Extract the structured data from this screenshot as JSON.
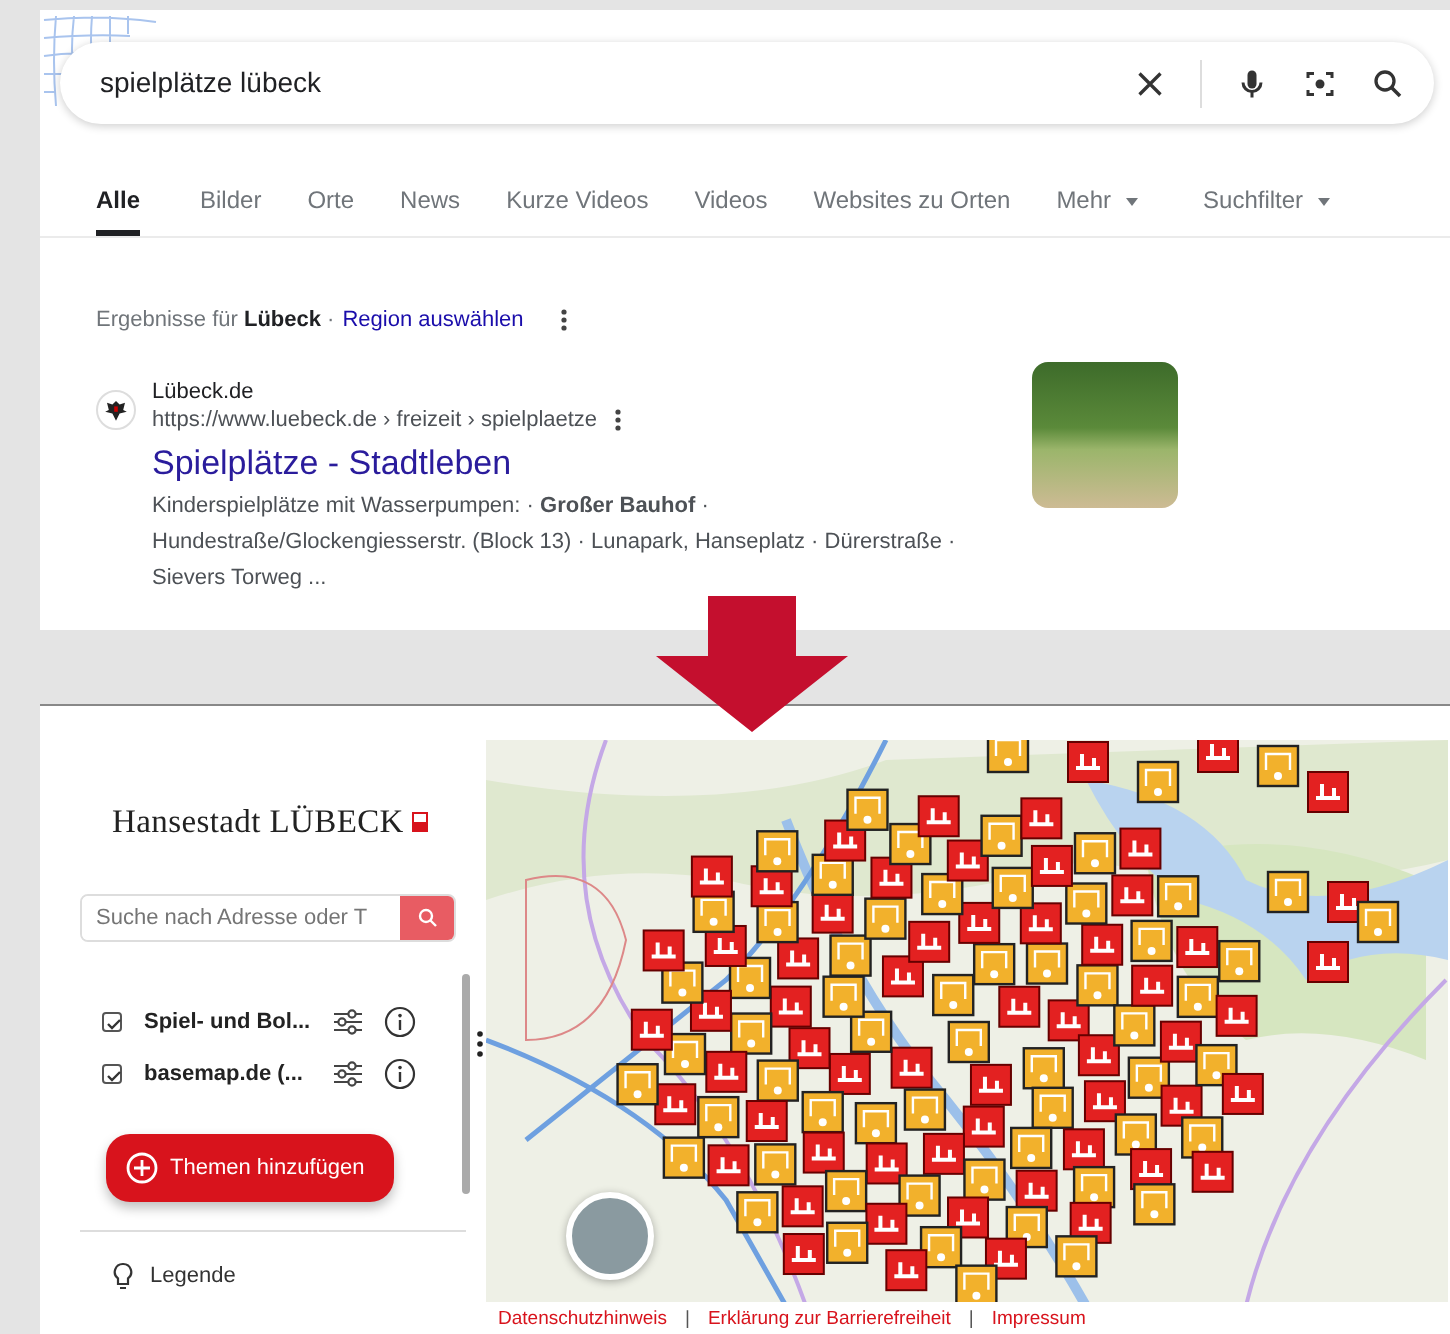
{
  "search": {
    "query": "spielplätze lübeck"
  },
  "tabs": [
    {
      "label": "Alle",
      "selected": true,
      "kind": "tab"
    },
    {
      "label": "Bilder",
      "selected": false,
      "kind": "tab"
    },
    {
      "label": "Orte",
      "selected": false,
      "kind": "tab"
    },
    {
      "label": "News",
      "selected": false,
      "kind": "tab"
    },
    {
      "label": "Kurze Videos",
      "selected": false,
      "kind": "tab"
    },
    {
      "label": "Videos",
      "selected": false,
      "kind": "tab"
    },
    {
      "label": "Websites zu Orten",
      "selected": false,
      "kind": "tab"
    },
    {
      "label": "Mehr",
      "selected": false,
      "kind": "dropdown"
    },
    {
      "label": "Suchfilter",
      "selected": false,
      "kind": "dropdown"
    }
  ],
  "region_notice": {
    "text": "Ergebnisse für **Lübeck** ·",
    "link": "Region auswählen"
  },
  "result": {
    "site": "Lübeck.de",
    "url": "https://www.luebeck.de › freizeit › spielplaetze",
    "title": "Spielplätze - Stadtleben",
    "snippet": "Kinderspielplätze mit Wasserpumpen: · **Großer Bauhof** · Hundestraße/Glockengiesserstr. (Block 13) · Lunapark, Hanseplatz · Dürerstraße · Sievers Torweg ..."
  },
  "map_app": {
    "logo": "Hansestadt LÜBECK",
    "search": {
      "placeholder": "Suche nach Adresse oder T"
    },
    "layers": [
      {
        "name": "Spiel- und Bol...",
        "checked": true
      },
      {
        "name": "basemap.de (...",
        "checked": true
      }
    ],
    "add_button": "Themen hinzufügen",
    "menu": [
      {
        "label": "Legende"
      }
    ],
    "footer": [
      {
        "kind": "link",
        "text": "Datenschutzhinweis"
      },
      {
        "kind": "separator",
        "text": "|"
      },
      {
        "kind": "link",
        "text": "Erklärung zur Barrierefreiheit"
      },
      {
        "kind": "separator",
        "text": "|"
      },
      {
        "kind": "link",
        "text": "Impressum"
      }
    ]
  }
}
